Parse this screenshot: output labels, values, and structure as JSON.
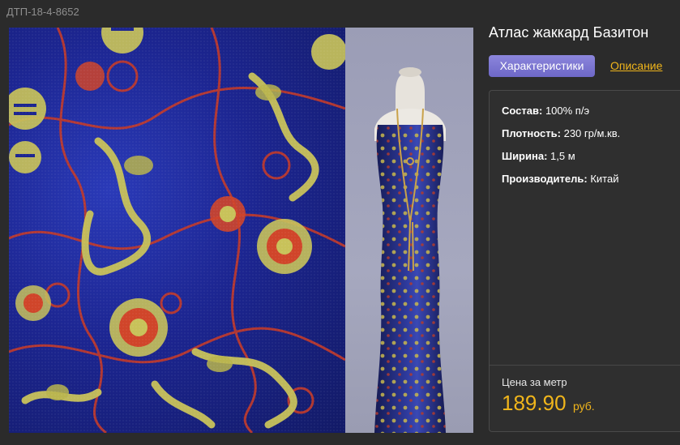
{
  "product": {
    "sku": "ДТП-18-4-8652",
    "title": "Атлас жаккард Базитон"
  },
  "tabs": {
    "active_label": "Характеристики",
    "other_label": "Описание"
  },
  "specs": [
    {
      "label": "Состав:",
      "value": "100% п/э"
    },
    {
      "label": "Плотность:",
      "value": "230 гр/м.кв."
    },
    {
      "label": "Ширина:",
      "value": "1,5 м"
    },
    {
      "label": "Производитель:",
      "value": "Китай"
    }
  ],
  "price": {
    "label": "Цена за метр",
    "value": "189.90",
    "currency": "руб."
  },
  "colors": {
    "background": "#2b2b2b",
    "accent": "#f0b51b",
    "tab_active": "#7a74d0",
    "fabric_blue": "#1c2590",
    "fabric_gold": "#c8c25a",
    "fabric_red": "#d0452a"
  }
}
